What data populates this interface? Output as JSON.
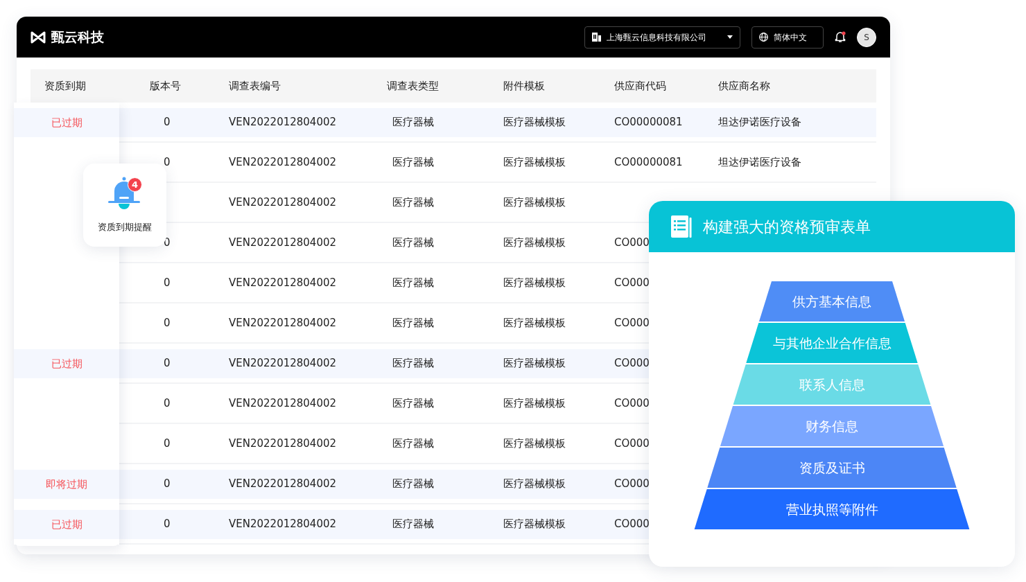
{
  "header": {
    "logo_text": "甄云科技",
    "company": "上海甄云信息科技有限公司",
    "language": "简体中文",
    "notification_dot": true,
    "avatar": "S"
  },
  "table": {
    "columns": [
      "资质到期",
      "版本号",
      "调查表编号",
      "调查表类型",
      "附件模板",
      "供应商代码",
      "供应商名称"
    ],
    "rows": [
      {
        "status": "已过期",
        "version": "0",
        "survey_no": "VEN2022012804002",
        "survey_type": "医疗器械",
        "template": "医疗器械模板",
        "supplier_code": "CO00000081",
        "supplier_name": "坦达伊诺医疗设备"
      },
      {
        "version": "0",
        "survey_no": "VEN2022012804002",
        "survey_type": "医疗器械",
        "template": "医疗器械模板",
        "supplier_code": "CO00000081",
        "supplier_name": "坦达伊诺医疗设备"
      },
      {
        "survey_no": "VEN2022012804002",
        "survey_type": "医疗器械",
        "template": "医疗器械模板"
      },
      {
        "version": "0",
        "survey_no": "VEN2022012804002",
        "survey_type": "医疗器械",
        "template": "医疗器械模板",
        "supplier_code": "CO000"
      },
      {
        "version": "0",
        "survey_no": "VEN2022012804002",
        "survey_type": "医疗器械",
        "template": "医疗器械模板",
        "supplier_code": "CO000"
      },
      {
        "version": "0",
        "survey_no": "VEN2022012804002",
        "survey_type": "医疗器械",
        "template": "医疗器械模板",
        "supplier_code": "CO000"
      },
      {
        "status": "已过期",
        "version": "0",
        "survey_no": "VEN2022012804002",
        "survey_type": "医疗器械",
        "template": "医疗器械模板",
        "supplier_code": "CO000"
      },
      {
        "version": "0",
        "survey_no": "VEN2022012804002",
        "survey_type": "医疗器械",
        "template": "医疗器械模板",
        "supplier_code": "CO000"
      },
      {
        "version": "0",
        "survey_no": "VEN2022012804002",
        "survey_type": "医疗器械",
        "template": "医疗器械模板",
        "supplier_code": "CO000"
      },
      {
        "status": "即将过期",
        "version": "0",
        "survey_no": "VEN2022012804002",
        "survey_type": "医疗器械",
        "template": "医疗器械模板",
        "supplier_code": "CO000"
      },
      {
        "status": "已过期",
        "version": "0",
        "survey_no": "VEN2022012804002",
        "survey_type": "医疗器械",
        "template": "医疗器械模板",
        "supplier_code": "CO000"
      }
    ]
  },
  "reminder": {
    "badge": "4",
    "label": "资质到期提醒"
  },
  "pyramid_card": {
    "title": "构建强大的资格预审表单",
    "tiers": [
      {
        "label": "供方基本信息",
        "color": "#4f8df6"
      },
      {
        "label": "与其他企业合作信息",
        "color": "#0bc4d8"
      },
      {
        "label": "联系人信息",
        "color": "#6adbe6"
      },
      {
        "label": "财务信息",
        "color": "#7aa6ff"
      },
      {
        "label": "资质及证书",
        "color": "#4c86f6"
      },
      {
        "label": "营业执照等附件",
        "color": "#1f6bff"
      }
    ]
  }
}
